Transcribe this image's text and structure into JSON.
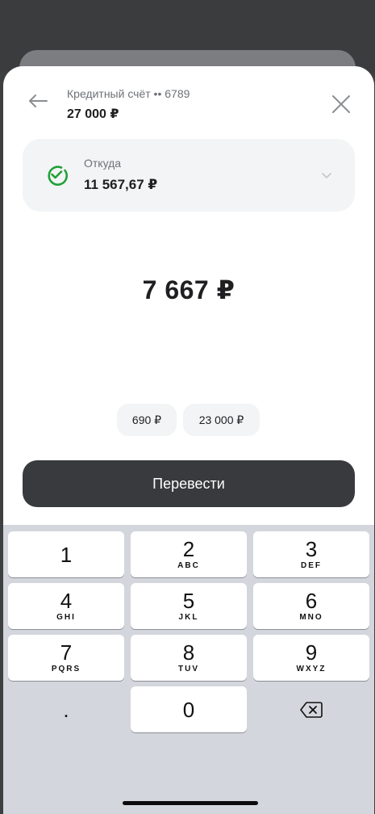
{
  "header": {
    "account_label": "Кредитный счёт •• 6789",
    "account_amount": "27 000 ₽"
  },
  "source": {
    "label": "Откуда",
    "amount": "11 567,67 ₽"
  },
  "amount": {
    "value": "7 667 ₽"
  },
  "chips": [
    {
      "label": "690 ₽"
    },
    {
      "label": "23 000 ₽"
    }
  ],
  "transfer_button": {
    "label": "Перевести"
  },
  "keypad": {
    "keys": [
      {
        "digit": "1",
        "letters": ""
      },
      {
        "digit": "2",
        "letters": "ABC"
      },
      {
        "digit": "3",
        "letters": "DEF"
      },
      {
        "digit": "4",
        "letters": "GHI"
      },
      {
        "digit": "5",
        "letters": "JKL"
      },
      {
        "digit": "6",
        "letters": "MNO"
      },
      {
        "digit": "7",
        "letters": "PQRS"
      },
      {
        "digit": "8",
        "letters": "TUV"
      },
      {
        "digit": "9",
        "letters": "WXYZ"
      },
      {
        "digit": ".",
        "letters": ""
      },
      {
        "digit": "0",
        "letters": ""
      }
    ]
  },
  "icons": {
    "back": "arrow-left-icon",
    "close": "close-icon",
    "source": "check-circle-icon",
    "chevron": "chevron-down-icon",
    "delete": "backspace-icon"
  },
  "colors": {
    "accent_green": "#21a038",
    "button_dark": "#383a3d",
    "card_bg": "#f2f4f5",
    "keypad_bg": "#d3d6dc"
  }
}
